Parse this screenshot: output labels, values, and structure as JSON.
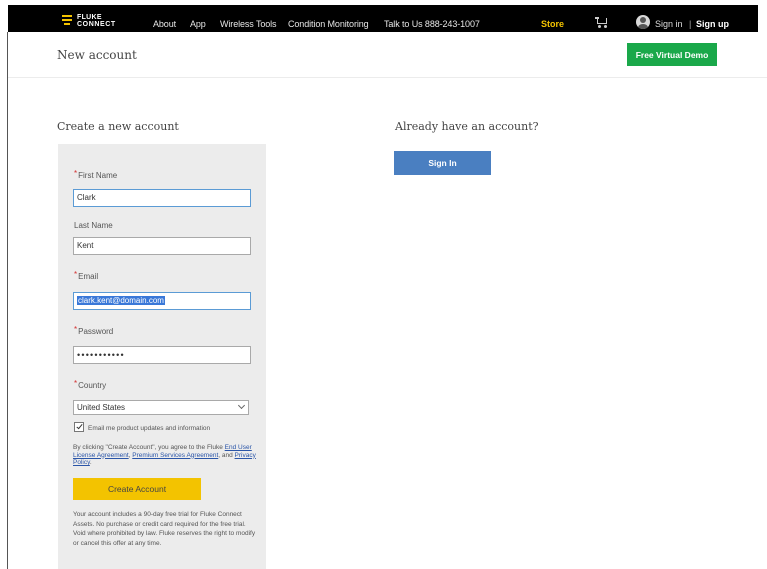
{
  "nav": {
    "logo_line1": "FLUKE",
    "logo_line2": "CONNECT",
    "links": [
      "About",
      "App",
      "Wireless Tools",
      "Condition Monitoring"
    ],
    "phone": "Talk to Us 888-243-1007",
    "store": "Store",
    "signin": "Sign in",
    "separator": "|",
    "signup": "Sign up",
    "colors": {
      "bar": "#000000",
      "accent": "#f3c300"
    },
    "icons": {
      "cart": "shopping-cart-icon",
      "user": "user-avatar-icon"
    }
  },
  "header": {
    "title": "New account",
    "demo_button": "Free Virtual Demo",
    "demo_color": "#1aa84a"
  },
  "create": {
    "heading": "Create a new account",
    "first_name_label": "First Name",
    "first_name_value": "Clark",
    "last_name_label": "Last Name",
    "last_name_value": "Kent",
    "email_label": "Email",
    "email_value": "clark.kent@domain.com",
    "password_label": "Password",
    "password_value": "•••••••••••",
    "country_label": "Country",
    "country_value": "United States",
    "required_mark": "*",
    "checkbox_label": "Email me product updates and information",
    "checkbox_checked": true,
    "terms_pre": "By clicking \"Create Account\", you agree to the Fluke ",
    "terms_eula": "End User License Agreement",
    "terms_sep1": ", ",
    "terms_premium": "Premium Services Agreement",
    "terms_sep2": ", and ",
    "terms_privacy": "Privacy Policy",
    "terms_end": ".",
    "button": "Create Account",
    "button_color": "#f3c300",
    "disclaimer": "Your account includes a 90-day free trial for Fluke Connect Assets. No purchase or credit card required for the free trial. Void where prohibited by law. Fluke reserves the right to modify or cancel this offer at any time."
  },
  "signin": {
    "heading": "Already have an account?",
    "button": "Sign In",
    "button_color": "#4a7fc1"
  }
}
